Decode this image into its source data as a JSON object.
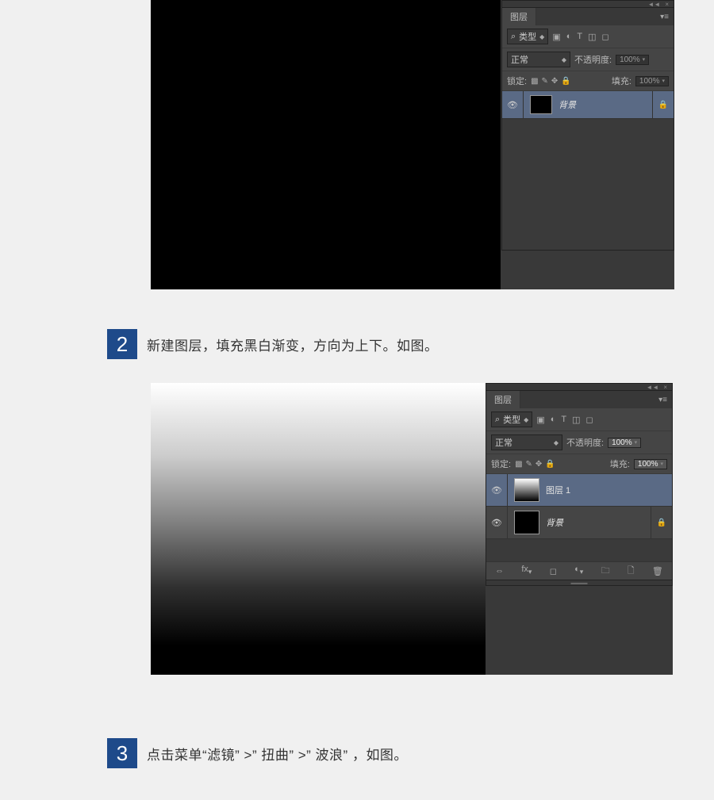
{
  "panel": {
    "title": "图层",
    "type_label": "类型",
    "blend_mode": "正常",
    "opacity_label": "不透明度:",
    "opacity_value": "100%",
    "lock_label": "锁定:",
    "fill_label": "填充:",
    "fill_value": "100%"
  },
  "fig1": {
    "layer_bg": "背景"
  },
  "fig2": {
    "layer1": "图层 1",
    "layer_bg": "背景"
  },
  "step2": {
    "num": "2",
    "text": "新建图层，填充黑白渐变，方向为上下。如图。"
  },
  "step3": {
    "num": "3",
    "text": "点击菜单“滤镜” >” 扭曲” >” 波浪” ，如图。"
  }
}
